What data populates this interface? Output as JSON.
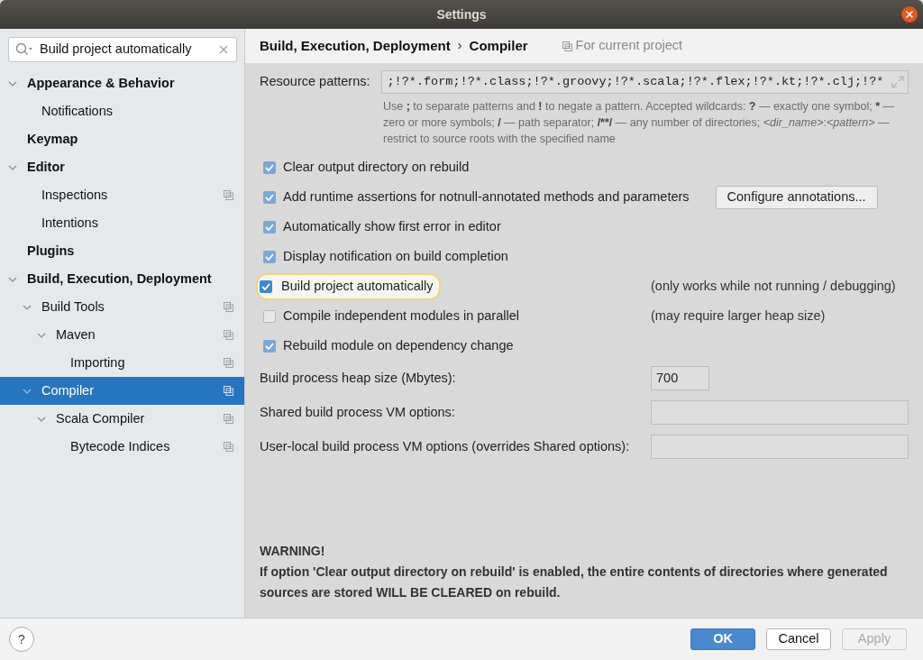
{
  "window": {
    "title": "Settings"
  },
  "search": {
    "value": "Build project automatically"
  },
  "sidebar": {
    "items": [
      {
        "label": "Appearance & Behavior",
        "expanded": true,
        "selected": false,
        "project_level": false,
        "children": [
          {
            "label": "Notifications",
            "selected": false,
            "project_level": false
          }
        ]
      },
      {
        "label": "Keymap",
        "selected": false,
        "project_level": false
      },
      {
        "label": "Editor",
        "expanded": true,
        "selected": false,
        "project_level": false,
        "children": [
          {
            "label": "Inspections",
            "selected": false,
            "project_level": true
          },
          {
            "label": "Intentions",
            "selected": false,
            "project_level": false
          }
        ]
      },
      {
        "label": "Plugins",
        "selected": false,
        "project_level": false
      },
      {
        "label": "Build, Execution, Deployment",
        "expanded": true,
        "selected": false,
        "project_level": false,
        "children": [
          {
            "label": "Build Tools",
            "expanded": true,
            "selected": false,
            "project_level": true,
            "children": [
              {
                "label": "Maven",
                "expanded": true,
                "selected": false,
                "project_level": true,
                "children": [
                  {
                    "label": "Importing",
                    "selected": false,
                    "project_level": true
                  }
                ]
              }
            ]
          },
          {
            "label": "Compiler",
            "expanded": true,
            "selected": true,
            "project_level": true,
            "children": [
              {
                "label": "Scala Compiler",
                "expanded": true,
                "selected": false,
                "project_level": true,
                "children": [
                  {
                    "label": "Bytecode Indices",
                    "selected": false,
                    "project_level": true
                  }
                ]
              }
            ]
          }
        ]
      }
    ]
  },
  "breadcrumb": {
    "items": [
      "Build, Execution, Deployment",
      "Compiler"
    ],
    "separator": "›",
    "scope": "For current project"
  },
  "resource_patterns": {
    "label": "Resource patterns:",
    "value": ";!?*.form;!?*.class;!?*.groovy;!?*.scala;!?*.flex;!?*.kt;!?*.clj;!?*",
    "help": [
      {
        "kind": "plain",
        "text": "Use "
      },
      {
        "kind": "bold",
        "text": ";"
      },
      {
        "kind": "plain",
        "text": " to separate patterns and "
      },
      {
        "kind": "bold",
        "text": "!"
      },
      {
        "kind": "plain",
        "text": " to negate a pattern. Accepted wildcards: "
      },
      {
        "kind": "bold",
        "text": "?"
      },
      {
        "kind": "plain",
        "text": " — exactly one symbol; "
      },
      {
        "kind": "bold",
        "text": "*"
      },
      {
        "kind": "plain",
        "text": " — zero or more symbols; "
      },
      {
        "kind": "bold",
        "text": "/"
      },
      {
        "kind": "plain",
        "text": " — path separator; "
      },
      {
        "kind": "bold",
        "text": "/**/"
      },
      {
        "kind": "plain",
        "text": " — any number of directories; "
      },
      {
        "kind": "italic",
        "text": "<dir_name>"
      },
      {
        "kind": "plain",
        "text": ":"
      },
      {
        "kind": "italic",
        "text": "<pattern>"
      },
      {
        "kind": "plain",
        "text": " — restrict to source roots with the specified name"
      }
    ]
  },
  "options": [
    {
      "kind": "checkbox",
      "label": "Clear output directory on rebuild",
      "checked": true,
      "focused": false
    },
    {
      "kind": "checkbox",
      "label": "Add runtime assertions for notnull-annotated methods and parameters",
      "checked": true,
      "focused": false,
      "button": "Configure annotations..."
    },
    {
      "kind": "checkbox",
      "label": "Automatically show first error in editor",
      "checked": true,
      "focused": false
    },
    {
      "kind": "checkbox",
      "label": "Display notification on build completion",
      "checked": true,
      "focused": false
    },
    {
      "kind": "checkbox",
      "label": "Build project automatically",
      "checked": true,
      "focused": true,
      "note": "(only works while not running / debugging)"
    },
    {
      "kind": "checkbox",
      "label": "Compile independent modules in parallel",
      "checked": false,
      "focused": false,
      "note": "(may require larger heap size)"
    },
    {
      "kind": "checkbox",
      "label": "Rebuild module on dependency change",
      "checked": true,
      "focused": false
    },
    {
      "kind": "field",
      "label": "Build process heap size (Mbytes):",
      "value": "700"
    },
    {
      "kind": "field",
      "label": "Shared build process VM options:"
    },
    {
      "kind": "field",
      "label": "User-local build process VM options (overrides Shared options):"
    }
  ],
  "warning": {
    "title": "WARNING!",
    "text": "If option 'Clear output directory on rebuild' is enabled, the entire contents of directories where generated sources are stored WILL BE CLEARED on rebuild."
  },
  "footer": {
    "help": "?",
    "buttons": [
      {
        "label": "OK",
        "kind": "primary",
        "disabled": false
      },
      {
        "label": "Cancel",
        "kind": "normal",
        "disabled": false
      },
      {
        "label": "Apply",
        "kind": "normal",
        "disabled": true
      }
    ]
  }
}
